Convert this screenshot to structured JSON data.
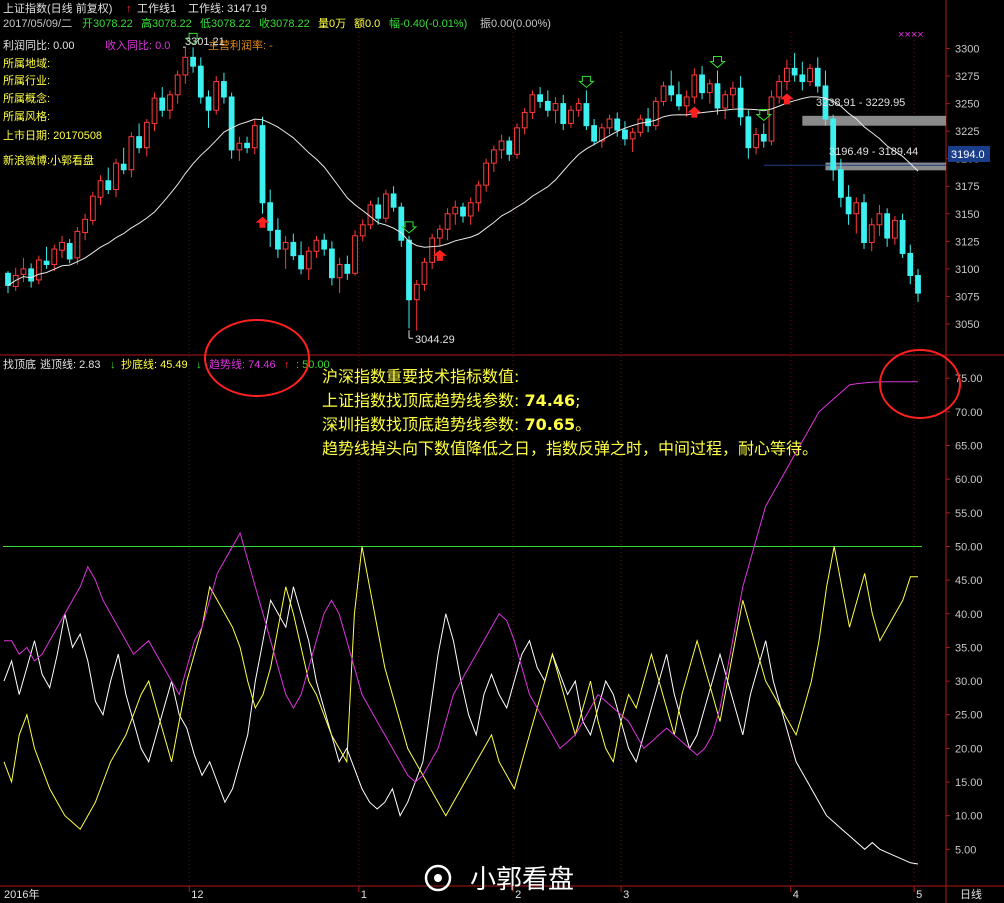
{
  "header": {
    "title": "上证指数(日线 前复权)",
    "workline_label": "工作线1",
    "workline_value": "工作线: 3147.19",
    "date": "2017/05/09/二",
    "open": "开3078.22",
    "high": "高3078.22",
    "low": "低3078.22",
    "close": "收3078.22",
    "volume": "量0万",
    "amount": "额0.0",
    "change": "幅-0.40(-0.01%)",
    "amplitude": "振0.00(0.00%)",
    "cross_marks": "××××"
  },
  "info_panel": {
    "profit_yoy": "利润同比: 0.00",
    "income_yoy": "收入同比: 0.0",
    "main_margin": "主营利润率: -",
    "region": "所属地域:",
    "industry": "所属行业:",
    "concept": "所属概念:",
    "style": "所属风格:",
    "listing_date": "上市日期: 20170508",
    "weibo": "新浪微博:小郭看盘"
  },
  "price_labels": {
    "high_marker": "3301.21",
    "low_marker": "3044.29",
    "zone1": "3238.91 - 3229.95",
    "zone2": "3196.49 - 3189.44",
    "current": "3194.0"
  },
  "indicator_header": {
    "name": "找顶底",
    "escape_label": "逃顶线: 2.83",
    "bottom_label": "抄底线: 45.49",
    "trend_label": "趋势线: 74.46",
    "level_label": ": 50.00"
  },
  "annotation": {
    "line1": "沪深指数重要技术指标数值:",
    "line2_prefix": "上证指数找顶底趋势线参数: ",
    "line2_value": "74.46",
    "line2_suffix": ";",
    "line3_prefix": "深圳指数找顶底趋势线参数: ",
    "line3_value": "70.65",
    "line3_suffix": "。",
    "line4": "趋势线掉头向下数值降低之日，指数反弹之时，中间过程，耐心等待。"
  },
  "x_axis": {
    "labels": [
      "2016年",
      "12",
      "1",
      "2",
      "3",
      "4",
      "5"
    ],
    "period": "日线"
  },
  "watermark": "小郭看盘",
  "colors": {
    "up": "#ff3a3a",
    "down": "#3cf0f0",
    "ma": "#e8e8e8",
    "escape": "#ffffff",
    "bottom": "#ffff44",
    "trend": "#dd33dd",
    "level": "#33dd33",
    "axis": "#b01818",
    "zone": "#8a8a8a"
  },
  "chart_data": [
    {
      "type": "candlestick",
      "title": "上证指数(日线 前复权)",
      "y_ticks": [
        3050,
        3075,
        3100,
        3125,
        3150,
        3175,
        3200,
        3225,
        3250,
        3275,
        3300
      ],
      "ylim": [
        3030,
        3315
      ],
      "x_ticks": [
        "2016年",
        "12",
        "1",
        "2",
        "3",
        "4",
        "5"
      ],
      "annotations": [
        {
          "text": "3301.21",
          "kind": "period-high"
        },
        {
          "text": "3044.29",
          "kind": "period-low"
        },
        {
          "text": "3238.91 - 3229.95",
          "kind": "resistance-zone",
          "range": [
            3229.95,
            3238.91
          ]
        },
        {
          "text": "3196.49 - 3189.44",
          "kind": "resistance-zone",
          "range": [
            3189.44,
            3196.49
          ]
        },
        {
          "text": "3194.0",
          "kind": "current-line"
        }
      ],
      "ohlc": [
        [
          3096,
          3098,
          3078,
          3085
        ],
        [
          3084,
          3101,
          3080,
          3094
        ],
        [
          3095,
          3110,
          3088,
          3100
        ],
        [
          3100,
          3105,
          3083,
          3089
        ],
        [
          3090,
          3112,
          3086,
          3108
        ],
        [
          3107,
          3120,
          3100,
          3104
        ],
        [
          3104,
          3122,
          3098,
          3118
        ],
        [
          3117,
          3130,
          3110,
          3124
        ],
        [
          3123,
          3127,
          3105,
          3109
        ],
        [
          3110,
          3138,
          3104,
          3134
        ],
        [
          3133,
          3150,
          3126,
          3145
        ],
        [
          3144,
          3170,
          3140,
          3166
        ],
        [
          3165,
          3185,
          3158,
          3180
        ],
        [
          3180,
          3192,
          3168,
          3172
        ],
        [
          3172,
          3200,
          3165,
          3196
        ],
        [
          3195,
          3210,
          3186,
          3190
        ],
        [
          3190,
          3224,
          3183,
          3220
        ],
        [
          3220,
          3232,
          3205,
          3210
        ],
        [
          3210,
          3236,
          3202,
          3233
        ],
        [
          3232,
          3260,
          3225,
          3255
        ],
        [
          3255,
          3265,
          3238,
          3244
        ],
        [
          3244,
          3262,
          3236,
          3258
        ],
        [
          3258,
          3280,
          3250,
          3276
        ],
        [
          3276,
          3302,
          3268,
          3292
        ],
        [
          3292,
          3301,
          3278,
          3284
        ],
        [
          3284,
          3292,
          3250,
          3256
        ],
        [
          3256,
          3262,
          3228,
          3244
        ],
        [
          3244,
          3275,
          3240,
          3270
        ],
        [
          3270,
          3278,
          3250,
          3256
        ],
        [
          3256,
          3260,
          3200,
          3208
        ],
        [
          3208,
          3220,
          3198,
          3214
        ],
        [
          3214,
          3220,
          3205,
          3210
        ],
        [
          3210,
          3235,
          3204,
          3230
        ],
        [
          3230,
          3238,
          3150,
          3160
        ],
        [
          3160,
          3172,
          3120,
          3135
        ],
        [
          3135,
          3146,
          3110,
          3118
        ],
        [
          3118,
          3130,
          3100,
          3124
        ],
        [
          3124,
          3132,
          3108,
          3112
        ],
        [
          3112,
          3125,
          3095,
          3100
        ],
        [
          3100,
          3120,
          3090,
          3116
        ],
        [
          3116,
          3130,
          3110,
          3126
        ],
        [
          3126,
          3132,
          3112,
          3118
        ],
        [
          3118,
          3125,
          3085,
          3092
        ],
        [
          3092,
          3110,
          3078,
          3104
        ],
        [
          3104,
          3112,
          3090,
          3096
        ],
        [
          3096,
          3135,
          3094,
          3130
        ],
        [
          3130,
          3145,
          3125,
          3140
        ],
        [
          3140,
          3162,
          3136,
          3158
        ],
        [
          3158,
          3165,
          3140,
          3146
        ],
        [
          3146,
          3172,
          3142,
          3168
        ],
        [
          3168,
          3175,
          3152,
          3156
        ],
        [
          3156,
          3160,
          3120,
          3126
        ],
        [
          3126,
          3130,
          3046,
          3072
        ],
        [
          3072,
          3090,
          3044,
          3086
        ],
        [
          3086,
          3110,
          3080,
          3106
        ],
        [
          3106,
          3132,
          3100,
          3128
        ],
        [
          3128,
          3140,
          3120,
          3136
        ],
        [
          3136,
          3155,
          3126,
          3150
        ],
        [
          3150,
          3162,
          3140,
          3156
        ],
        [
          3156,
          3160,
          3142,
          3148
        ],
        [
          3148,
          3165,
          3140,
          3160
        ],
        [
          3160,
          3180,
          3152,
          3176
        ],
        [
          3176,
          3200,
          3170,
          3196
        ],
        [
          3196,
          3212,
          3188,
          3208
        ],
        [
          3208,
          3222,
          3200,
          3216
        ],
        [
          3216,
          3220,
          3198,
          3204
        ],
        [
          3204,
          3232,
          3200,
          3228
        ],
        [
          3228,
          3246,
          3222,
          3242
        ],
        [
          3242,
          3262,
          3236,
          3258
        ],
        [
          3258,
          3265,
          3246,
          3252
        ],
        [
          3252,
          3262,
          3238,
          3244
        ],
        [
          3244,
          3256,
          3232,
          3250
        ],
        [
          3250,
          3258,
          3226,
          3232
        ],
        [
          3232,
          3248,
          3228,
          3244
        ],
        [
          3244,
          3255,
          3238,
          3250
        ],
        [
          3250,
          3262,
          3226,
          3230
        ],
        [
          3230,
          3236,
          3212,
          3216
        ],
        [
          3216,
          3232,
          3210,
          3228
        ],
        [
          3228,
          3240,
          3222,
          3236
        ],
        [
          3236,
          3242,
          3220,
          3226
        ],
        [
          3226,
          3234,
          3212,
          3218
        ],
        [
          3218,
          3228,
          3206,
          3224
        ],
        [
          3224,
          3240,
          3220,
          3236
        ],
        [
          3236,
          3246,
          3224,
          3230
        ],
        [
          3230,
          3256,
          3226,
          3252
        ],
        [
          3252,
          3270,
          3248,
          3266
        ],
        [
          3266,
          3280,
          3252,
          3258
        ],
        [
          3258,
          3270,
          3244,
          3248
        ],
        [
          3248,
          3262,
          3238,
          3256
        ],
        [
          3256,
          3282,
          3250,
          3276
        ],
        [
          3276,
          3284,
          3254,
          3260
        ],
        [
          3260,
          3272,
          3250,
          3268
        ],
        [
          3268,
          3280,
          3240,
          3246
        ],
        [
          3246,
          3262,
          3236,
          3258
        ],
        [
          3258,
          3270,
          3246,
          3264
        ],
        [
          3264,
          3275,
          3230,
          3238
        ],
        [
          3238,
          3244,
          3200,
          3210
        ],
        [
          3210,
          3228,
          3204,
          3222
        ],
        [
          3222,
          3232,
          3210,
          3216
        ],
        [
          3216,
          3262,
          3212,
          3256
        ],
        [
          3256,
          3276,
          3250,
          3270
        ],
        [
          3270,
          3290,
          3262,
          3282
        ],
        [
          3282,
          3296,
          3270,
          3276
        ],
        [
          3276,
          3288,
          3262,
          3270
        ],
        [
          3270,
          3286,
          3266,
          3282
        ],
        [
          3282,
          3292,
          3260,
          3266
        ],
        [
          3266,
          3280,
          3230,
          3236
        ],
        [
          3236,
          3240,
          3180,
          3190
        ],
        [
          3190,
          3200,
          3156,
          3165
        ],
        [
          3165,
          3176,
          3140,
          3150
        ],
        [
          3150,
          3165,
          3132,
          3160
        ],
        [
          3160,
          3168,
          3118,
          3124
        ],
        [
          3124,
          3146,
          3116,
          3140
        ],
        [
          3140,
          3158,
          3130,
          3150
        ],
        [
          3150,
          3155,
          3120,
          3128
        ],
        [
          3128,
          3148,
          3122,
          3144
        ],
        [
          3144,
          3150,
          3110,
          3114
        ],
        [
          3114,
          3122,
          3086,
          3094
        ],
        [
          3094,
          3100,
          3070,
          3078
        ]
      ],
      "ma_last": 3147.19
    },
    {
      "type": "line",
      "title": "找顶底",
      "y_ticks": [
        5,
        10,
        15,
        20,
        25,
        30,
        35,
        40,
        45,
        50,
        55,
        60,
        65,
        70,
        75
      ],
      "ylim": [
        0,
        78
      ],
      "reference_line": 50,
      "series": [
        {
          "name": "逃顶线",
          "last": 2.83,
          "values": [
            30,
            33,
            28,
            32,
            36,
            31,
            29,
            34,
            40,
            35,
            37,
            33,
            27,
            25,
            30,
            34,
            28,
            24,
            20,
            18,
            22,
            26,
            30,
            25,
            23,
            19,
            16,
            18,
            15,
            12,
            14,
            18,
            22,
            30,
            36,
            42,
            40,
            38,
            44,
            40,
            36,
            30,
            26,
            22,
            18,
            20,
            17,
            14,
            12,
            11,
            12,
            14,
            10,
            12,
            15,
            18,
            26,
            34,
            40,
            36,
            30,
            25,
            22,
            28,
            31,
            28,
            26,
            30,
            34,
            36,
            32,
            30,
            34,
            31,
            28,
            30,
            24,
            22,
            26,
            30,
            28,
            24,
            20,
            18,
            22,
            26,
            30,
            34,
            28,
            24,
            20,
            22,
            26,
            30,
            34,
            30,
            26,
            22,
            28,
            32,
            36,
            30,
            26,
            22,
            18,
            16,
            14,
            12,
            10,
            9,
            8,
            7,
            6,
            5,
            6,
            5,
            4.5,
            4,
            3.5,
            3,
            2.83
          ]
        },
        {
          "name": "抄底线",
          "last": 45.49,
          "values": [
            18,
            15,
            22,
            25,
            20,
            17,
            14,
            12,
            10,
            9,
            8,
            10,
            12,
            15,
            18,
            20,
            22,
            25,
            28,
            30,
            26,
            22,
            18,
            24,
            30,
            34,
            38,
            44,
            42,
            40,
            38,
            35,
            30,
            26,
            28,
            32,
            38,
            44,
            40,
            35,
            30,
            28,
            25,
            22,
            20,
            18,
            40,
            50,
            44,
            38,
            32,
            28,
            24,
            20,
            18,
            16,
            14,
            12,
            10,
            12,
            14,
            16,
            18,
            20,
            22,
            18,
            16,
            14,
            18,
            22,
            26,
            30,
            34,
            30,
            26,
            22,
            26,
            30,
            24,
            20,
            18,
            24,
            28,
            26,
            30,
            34,
            30,
            26,
            22,
            28,
            32,
            36,
            32,
            28,
            24,
            30,
            36,
            42,
            38,
            34,
            30,
            28,
            26,
            24,
            22,
            26,
            30,
            36,
            44,
            50,
            44,
            38,
            42,
            46,
            40,
            36,
            38,
            40,
            42,
            45.49,
            45.49
          ]
        },
        {
          "name": "趋势线",
          "last": 74.46,
          "values": [
            36,
            36,
            34,
            35,
            33,
            34,
            36,
            38,
            40,
            42,
            44,
            47,
            45,
            42,
            40,
            38,
            36,
            34,
            35,
            36,
            34,
            32,
            30,
            28,
            32,
            36,
            38,
            42,
            46,
            48,
            50,
            52,
            48,
            44,
            40,
            36,
            32,
            28,
            26,
            28,
            32,
            36,
            40,
            42,
            40,
            36,
            32,
            28,
            26,
            24,
            22,
            20,
            18,
            16,
            15,
            16,
            18,
            20,
            24,
            28,
            30,
            32,
            34,
            36,
            38,
            40,
            39,
            36,
            32,
            28,
            26,
            24,
            22,
            20,
            21,
            22,
            24,
            26,
            28,
            27,
            26,
            25,
            24,
            22,
            20,
            21,
            22,
            23,
            22,
            21,
            20,
            19,
            20,
            22,
            26,
            32,
            38,
            44,
            48,
            52,
            56,
            58,
            60,
            62,
            64,
            66,
            68,
            70,
            71,
            72,
            73,
            74,
            74.2,
            74.3,
            74.4,
            74.45,
            74.46,
            74.46,
            74.46,
            74.46,
            74.46
          ]
        }
      ]
    }
  ]
}
